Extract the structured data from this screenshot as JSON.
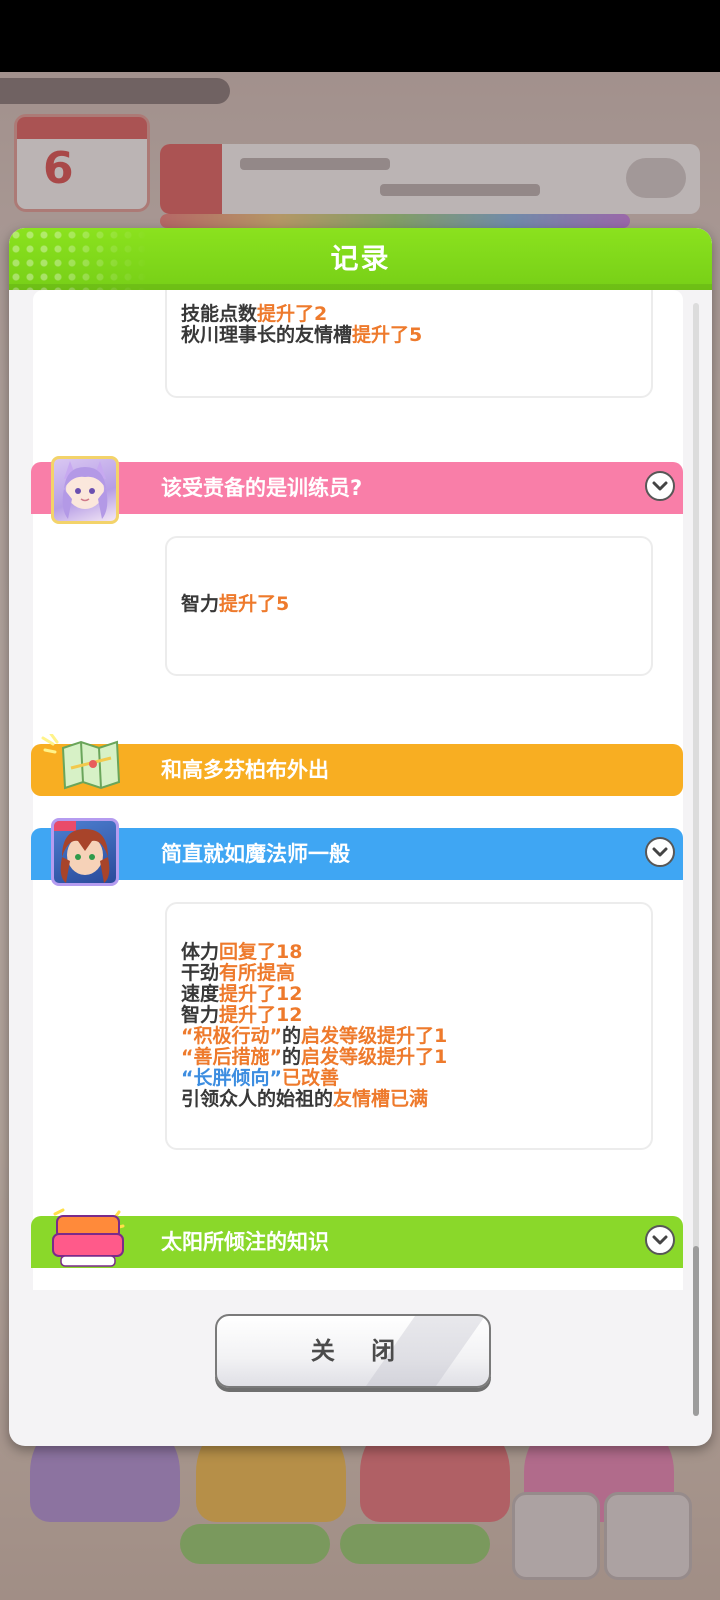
{
  "dialog": {
    "title": "记录",
    "close_label": "关 闭"
  },
  "background": {
    "calendar_day": "6",
    "colors": {
      "header_green": "#7fd81a",
      "pink": "#f97ea8",
      "orange": "#f8ae22",
      "blue": "#3fa6f3",
      "green": "#8ad82a",
      "highlight_orange": "#ee7a2c",
      "highlight_blue": "#3c8de0"
    }
  },
  "entries": [
    {
      "lines": [
        {
          "segments": [
            {
              "text": "技能点数",
              "hl": false
            },
            {
              "text": "提升了2",
              "hl": "orange"
            }
          ]
        },
        {
          "segments": [
            {
              "text": "秋川理事长的友情槽",
              "hl": false
            },
            {
              "text": "提升了5",
              "hl": "orange"
            }
          ]
        }
      ]
    },
    {
      "title": "该受责备的是训练员?",
      "lines": [
        {
          "segments": [
            {
              "text": "智力",
              "hl": false
            },
            {
              "text": "提升了5",
              "hl": "orange"
            }
          ]
        }
      ]
    },
    {
      "title": "和高多芬柏布外出"
    },
    {
      "title": "简直就如魔法师一般",
      "lines": [
        {
          "segments": [
            {
              "text": "体力",
              "hl": false
            },
            {
              "text": "回复了18",
              "hl": "orange"
            }
          ]
        },
        {
          "segments": [
            {
              "text": "干劲",
              "hl": false
            },
            {
              "text": "有所提高",
              "hl": "orange"
            }
          ]
        },
        {
          "segments": [
            {
              "text": "速度",
              "hl": false
            },
            {
              "text": "提升了12",
              "hl": "orange"
            }
          ]
        },
        {
          "segments": [
            {
              "text": "智力",
              "hl": false
            },
            {
              "text": "提升了12",
              "hl": "orange"
            }
          ]
        },
        {
          "segments": [
            {
              "text": "“积极行动”",
              "hl": "orange"
            },
            {
              "text": "的",
              "hl": false
            },
            {
              "text": "启发等级提升了1",
              "hl": "orange"
            }
          ]
        },
        {
          "segments": [
            {
              "text": "“善后措施”",
              "hl": "orange"
            },
            {
              "text": "的",
              "hl": false
            },
            {
              "text": "启发等级提升了1",
              "hl": "orange"
            }
          ]
        },
        {
          "segments": [
            {
              "text": "“长胖倾向”",
              "hl": "blue"
            },
            {
              "text": "已改善",
              "hl": "orange"
            }
          ]
        },
        {
          "segments": [
            {
              "text": "引领众人的始祖的",
              "hl": false
            },
            {
              "text": "友情槽已满",
              "hl": "orange"
            }
          ]
        }
      ]
    },
    {
      "title": "太阳所倾注的知识"
    }
  ]
}
